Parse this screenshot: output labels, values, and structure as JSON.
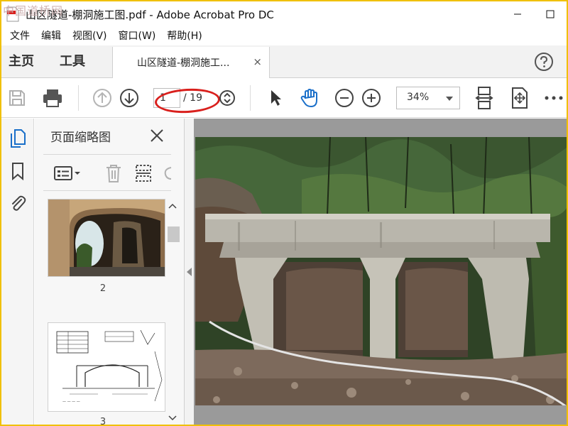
{
  "window": {
    "title": "山区隧道-棚洞施工图.pdf - Adobe Acrobat Pro DC",
    "watermark": "中国道桥网"
  },
  "menubar": {
    "items": [
      {
        "label": "文件"
      },
      {
        "label": "编辑"
      },
      {
        "label": "视图(V)"
      },
      {
        "label": "窗口(W)"
      },
      {
        "label": "帮助(H)"
      }
    ]
  },
  "tabbar": {
    "home": "主页",
    "tools": "工具",
    "doc_tab": "山区隧道-棚洞施工...",
    "close_glyph": "×"
  },
  "toolbar": {
    "page_current": "1",
    "page_total": "/ 19",
    "zoom": "34%"
  },
  "thumbnail_panel": {
    "title": "页面缩略图",
    "thumbnails": [
      {
        "label": "2"
      },
      {
        "label": "3"
      }
    ]
  },
  "colors": {
    "accent_blue": "#1a6fc9",
    "annotation_red": "#d9201d",
    "window_border": "#f0c000"
  }
}
